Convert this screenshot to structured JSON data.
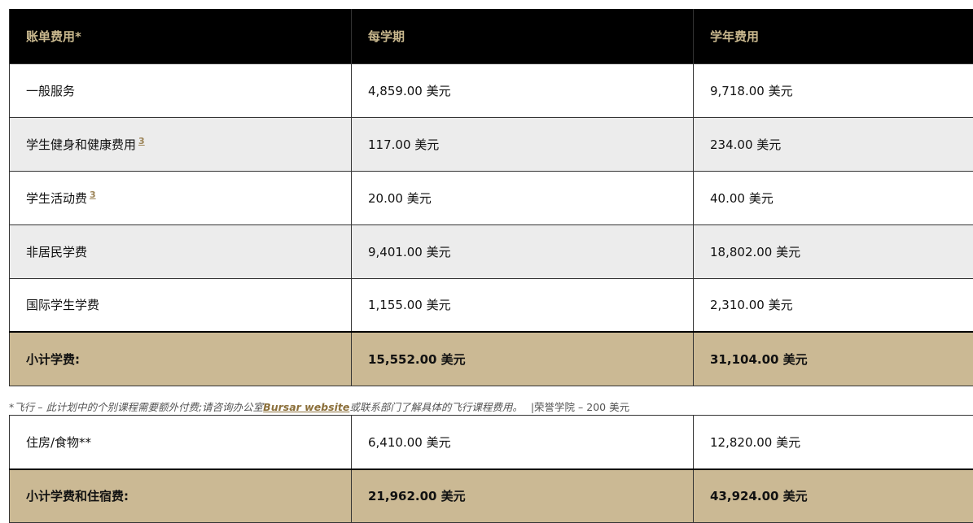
{
  "header": {
    "col1": "账单费用*",
    "col2": "每学期",
    "col3": "学年费用"
  },
  "rows": [
    {
      "label": "一般服务",
      "sup": "",
      "semester": "4,859.00 美元",
      "year": "9,718.00 美元"
    },
    {
      "label": "学生健身和健康费用",
      "sup": "3",
      "semester": "117.00 美元",
      "year": "234.00 美元"
    },
    {
      "label": "学生活动费",
      "sup": "3",
      "semester": "20.00 美元",
      "year": "40.00 美元"
    },
    {
      "label": "非居民学费",
      "sup": "",
      "semester": "9,401.00 美元",
      "year": "18,802.00 美元"
    },
    {
      "label": "国际学生学费",
      "sup": "",
      "semester": "1,155.00 美元",
      "year": "2,310.00 美元"
    }
  ],
  "subtotal": {
    "label": "小计学费:",
    "semester": "15,552.00 美元",
    "year": "31,104.00 美元"
  },
  "note": {
    "text_before": "*飞行 – 此计划中的个别课程需要额外付费;请咨询办公室",
    "link": "Bursar website",
    "text_after": "或联系部门了解具体的飞行课程费用。",
    "honors": "|荣誉学院 – 200 美元"
  },
  "housing": {
    "label": "住房/食物**",
    "semester": "6,410.00 美元",
    "year": "12,820.00 美元"
  },
  "subtotal2": {
    "label": "小计学费和住宿费:",
    "semester": "21,962.00 美元",
    "year": "43,924.00 美元"
  },
  "colors": {
    "header_bg": "#000000",
    "header_text": "#c9b88e",
    "subtotal_bg": "#cbb994",
    "alt_row_bg": "#ececec",
    "link": "#8b6f3a"
  }
}
